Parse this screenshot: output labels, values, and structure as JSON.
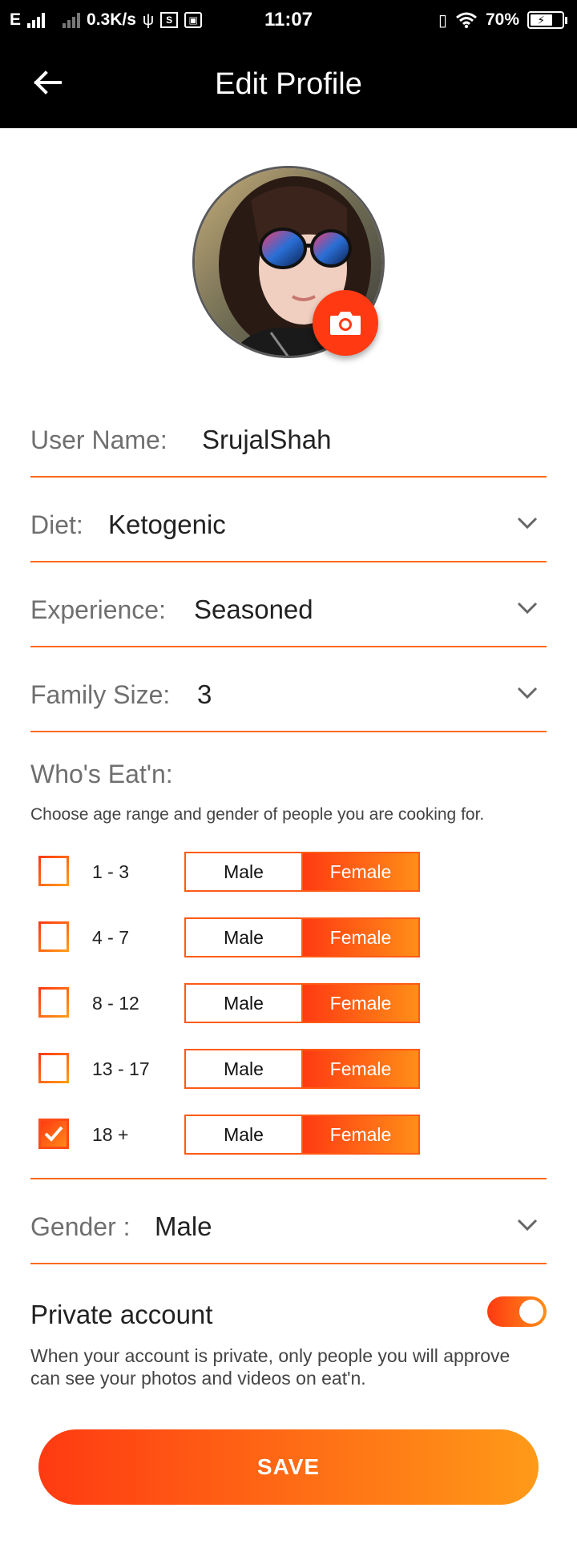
{
  "status_bar": {
    "network_type": "E",
    "speed": "0.3K/s",
    "time": "11:07",
    "battery": "70%",
    "usb_icon": "usb-icon",
    "vibrate_icon": "vibrate-icon",
    "wifi_icon": "wifi-icon"
  },
  "app_bar": {
    "title": "Edit Profile",
    "back_icon": "arrow-left-icon"
  },
  "profile": {
    "camera_icon": "camera-icon"
  },
  "fields": {
    "username": {
      "label": "User Name:",
      "value": "SrujalShah"
    },
    "diet": {
      "label": "Diet:",
      "value": "Ketogenic"
    },
    "experience": {
      "label": "Experience:",
      "value": "Seasoned"
    },
    "family_size": {
      "label": "Family Size:",
      "value": "3"
    },
    "gender": {
      "label": "Gender :",
      "value": "Male"
    }
  },
  "whos_eatn": {
    "title": "Who's Eat'n:",
    "description": "Choose age range and gender of people you are cooking for.",
    "rows": [
      {
        "range": "1 - 3",
        "checked": false,
        "male": "Male",
        "female": "Female",
        "selected": "Female"
      },
      {
        "range": "4 - 7",
        "checked": false,
        "male": "Male",
        "female": "Female",
        "selected": "Female"
      },
      {
        "range": "8 - 12",
        "checked": false,
        "male": "Male",
        "female": "Female",
        "selected": "Female"
      },
      {
        "range": "13 - 17",
        "checked": false,
        "male": "Male",
        "female": "Female",
        "selected": "Female"
      },
      {
        "range": "18 +",
        "checked": true,
        "male": "Male",
        "female": "Female",
        "selected": "Female"
      }
    ]
  },
  "private_account": {
    "title": "Private account",
    "enabled": true,
    "description": "When your account is private, only people you will approve can see your photos and videos on eat'n."
  },
  "save_label": "SAVE",
  "colors": {
    "accent_start": "#ff3a12",
    "accent_end": "#ff9a18",
    "underline": "#ff6a1a"
  }
}
